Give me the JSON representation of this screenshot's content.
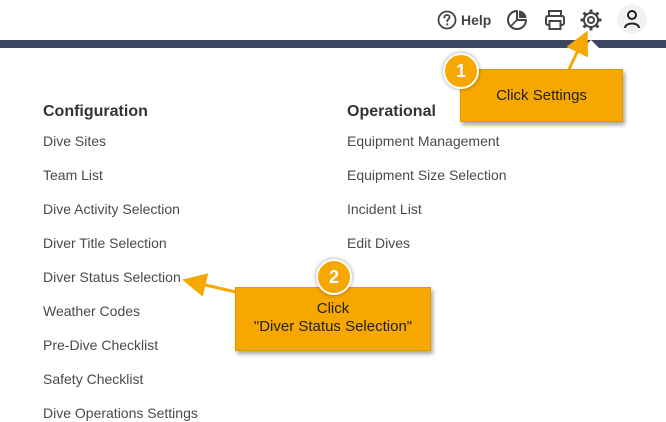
{
  "header": {
    "help_label": "Help",
    "icons": [
      "help-icon",
      "reports-icon",
      "print-icon",
      "settings-icon",
      "user-icon"
    ]
  },
  "configuration": {
    "title": "Configuration",
    "items": [
      "Dive Sites",
      "Team List",
      "Dive Activity Selection",
      "Diver Title Selection",
      "Diver Status Selection",
      "Weather Codes",
      "Pre-Dive Checklist",
      "Safety Checklist",
      "Dive Operations Settings"
    ]
  },
  "operational": {
    "title": "Operational",
    "items": [
      "Equipment Management",
      "Equipment Size Selection",
      "Incident List",
      "Edit Dives"
    ]
  },
  "callouts": [
    {
      "step": "1",
      "text": "Click Settings"
    },
    {
      "step": "2",
      "line1": "Click",
      "line2": "\"Diver Status Selection\""
    }
  ],
  "colors": {
    "nav_bar": "#3b4661",
    "callout": "#f6a800",
    "text": "#4a4a4a"
  }
}
